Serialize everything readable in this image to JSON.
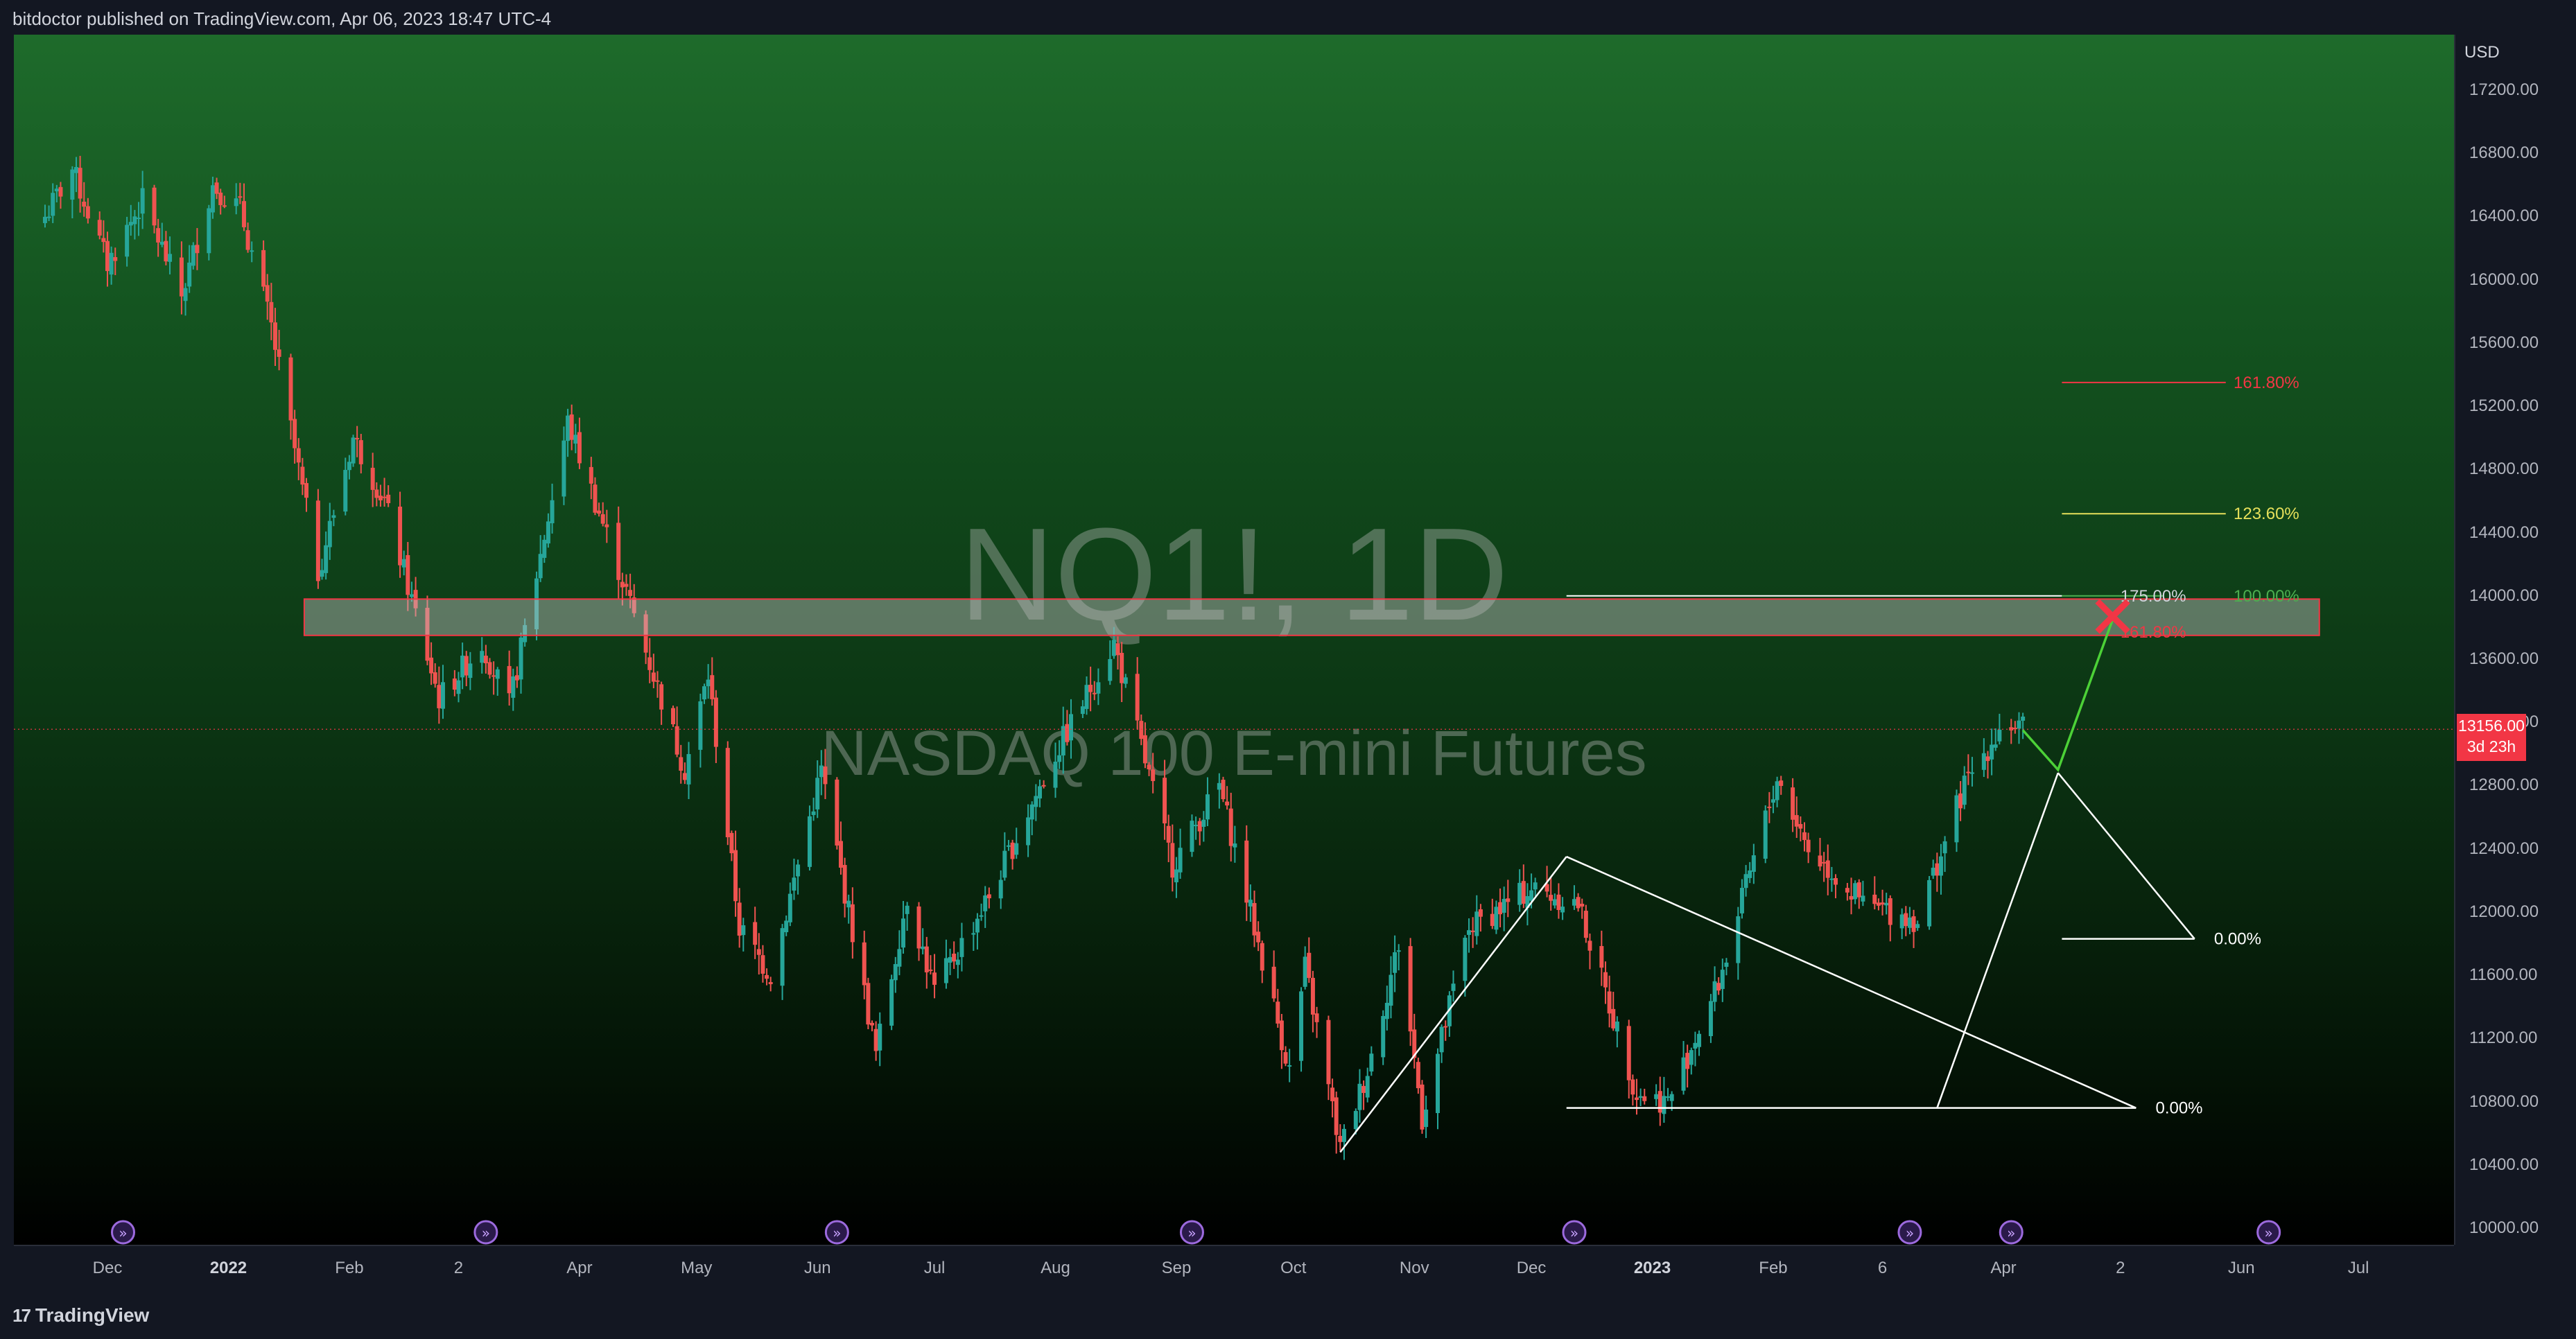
{
  "header": {
    "text": "bitdoctor published on TradingView.com, Apr 06, 2023 18:47 UTC-4"
  },
  "footer": {
    "brand": "TradingView",
    "logo_mark": "17"
  },
  "watermark": {
    "symbol": "NQ1!, 1D",
    "description": "NASDAQ 100 E-mini Futures"
  },
  "price_axis": {
    "currency": "USD",
    "last_price": "13156.00",
    "countdown": "3d 23h"
  },
  "colors": {
    "up": "#26a69a",
    "down": "#ef5350",
    "bg_top": "#1e6b2b",
    "bg_bottom": "#000000",
    "zone_border": "#f23645",
    "fib_red": "#f23645",
    "fib_yellow": "#e6e05a",
    "fib_green": "#4caf50",
    "projection": "#4cd137"
  },
  "chart_data": {
    "type": "candlestick",
    "title": "NQ1!, 1D",
    "subtitle": "NASDAQ 100 E-mini Futures",
    "ylim": [
      9750,
      17600
    ],
    "y_ticks": [
      10000,
      10400,
      10800,
      11200,
      11600,
      12000,
      12400,
      12800,
      13200,
      13600,
      14000,
      14400,
      14800,
      15200,
      15600,
      16000,
      16400,
      16800,
      17200
    ],
    "y_tick_labels": [
      "10000.00",
      "10400.00",
      "10800.00",
      "11200.00",
      "11600.00",
      "12000.00",
      "12400.00",
      "12800.00",
      "13200.00",
      "13600.00",
      "14000.00",
      "14400.00",
      "14800.00",
      "15200.00",
      "15600.00",
      "16000.00",
      "16400.00",
      "16800.00",
      "17200.00"
    ],
    "x_ticks": [
      {
        "label": "Dec",
        "bold": false,
        "date": "2021-12-01"
      },
      {
        "label": "2022",
        "bold": true,
        "date": "2022-01-01"
      },
      {
        "label": "Feb",
        "bold": false,
        "date": "2022-02-01"
      },
      {
        "label": "2",
        "bold": false,
        "date": "2022-03-01"
      },
      {
        "label": "Apr",
        "bold": false,
        "date": "2022-04-01"
      },
      {
        "label": "May",
        "bold": false,
        "date": "2022-05-01"
      },
      {
        "label": "Jun",
        "bold": false,
        "date": "2022-06-01"
      },
      {
        "label": "Jul",
        "bold": false,
        "date": "2022-07-01"
      },
      {
        "label": "Aug",
        "bold": false,
        "date": "2022-08-01"
      },
      {
        "label": "Sep",
        "bold": false,
        "date": "2022-09-01"
      },
      {
        "label": "Oct",
        "bold": false,
        "date": "2022-10-01"
      },
      {
        "label": "Nov",
        "bold": false,
        "date": "2022-11-01"
      },
      {
        "label": "Dec",
        "bold": false,
        "date": "2022-12-01"
      },
      {
        "label": "2023",
        "bold": true,
        "date": "2023-01-01"
      },
      {
        "label": "Feb",
        "bold": false,
        "date": "2023-02-01"
      },
      {
        "label": "6",
        "bold": false,
        "date": "2023-03-01"
      },
      {
        "label": "Apr",
        "bold": false,
        "date": "2023-04-01"
      },
      {
        "label": "2",
        "bold": false,
        "date": "2023-05-01"
      },
      {
        "label": "Jun",
        "bold": false,
        "date": "2023-06-01"
      },
      {
        "label": "Jul",
        "bold": false,
        "date": "2023-07-01"
      }
    ],
    "price_path": [
      [
        "2021-11-15",
        16400
      ],
      [
        "2021-11-22",
        16700
      ],
      [
        "2021-12-01",
        16100
      ],
      [
        "2021-12-10",
        16500
      ],
      [
        "2021-12-20",
        15900
      ],
      [
        "2021-12-28",
        16600
      ],
      [
        "2022-01-04",
        16450
      ],
      [
        "2022-01-12",
        15700
      ],
      [
        "2022-01-24",
        14150
      ],
      [
        "2022-02-02",
        15000
      ],
      [
        "2022-02-10",
        14600
      ],
      [
        "2022-02-24",
        13350
      ],
      [
        "2022-03-07",
        13700
      ],
      [
        "2022-03-14",
        13300
      ],
      [
        "2022-03-29",
        15100
      ],
      [
        "2022-04-12",
        14100
      ],
      [
        "2022-04-28",
        12900
      ],
      [
        "2022-05-04",
        13500
      ],
      [
        "2022-05-12",
        11900
      ],
      [
        "2022-05-20",
        11600
      ],
      [
        "2022-06-02",
        12900
      ],
      [
        "2022-06-16",
        11100
      ],
      [
        "2022-06-24",
        12100
      ],
      [
        "2022-07-01",
        11500
      ],
      [
        "2022-07-15",
        12100
      ],
      [
        "2022-08-01",
        13000
      ],
      [
        "2022-08-16",
        13700
      ],
      [
        "2022-08-31",
        12300
      ],
      [
        "2022-09-12",
        12800
      ],
      [
        "2022-09-30",
        11000
      ],
      [
        "2022-10-04",
        11650
      ],
      [
        "2022-10-13",
        10500
      ],
      [
        "2022-10-20",
        11000
      ],
      [
        "2022-10-28",
        11800
      ],
      [
        "2022-11-03",
        10700
      ],
      [
        "2022-11-15",
        11900
      ],
      [
        "2022-12-01",
        12150
      ],
      [
        "2022-12-13",
        12050
      ],
      [
        "2022-12-28",
        10850
      ],
      [
        "2023-01-05",
        10800
      ],
      [
        "2023-01-18",
        11550
      ],
      [
        "2023-02-02",
        12850
      ],
      [
        "2023-02-10",
        12400
      ],
      [
        "2023-02-24",
        12050
      ],
      [
        "2023-03-10",
        11950
      ],
      [
        "2023-03-22",
        12800
      ],
      [
        "2023-04-01",
        13200
      ],
      [
        "2023-04-06",
        13156
      ]
    ],
    "last_price": 13156,
    "resistance_zone": [
      13750,
      13980
    ],
    "fib_levels": [
      {
        "label": "161.80%",
        "price": 15350,
        "color": "#f23645"
      },
      {
        "label": "123.60%",
        "price": 14520,
        "color": "#e6e05a"
      },
      {
        "label": "175.00%",
        "price": 14000,
        "color": "#ffffff"
      },
      {
        "label": "100.00%",
        "price": 14000,
        "color": "#4caf50"
      },
      {
        "label": "161.80%",
        "price": 13770,
        "color": "#f23645"
      },
      {
        "label": "0.00%",
        "price": 11830,
        "color": "#ffffff"
      },
      {
        "label": "0.00%",
        "price": 10760,
        "color": "#ffffff"
      }
    ],
    "triangle": {
      "apex_date": "2022-12-10",
      "apex_price": 12350,
      "low_date": "2022-10-13",
      "low_price": 10480,
      "right_date": "2023-05-05",
      "right_price": 10760
    },
    "projection": [
      [
        "2023-04-06",
        13150
      ],
      [
        "2023-04-15",
        12900
      ],
      [
        "2023-04-29",
        13850
      ]
    ],
    "events": [
      "2021-12-05",
      "2022-03-08",
      "2022-06-06",
      "2022-09-05",
      "2022-12-12",
      "2023-03-08",
      "2023-04-03",
      "2023-06-08"
    ],
    "legend": "none",
    "grid": false
  }
}
